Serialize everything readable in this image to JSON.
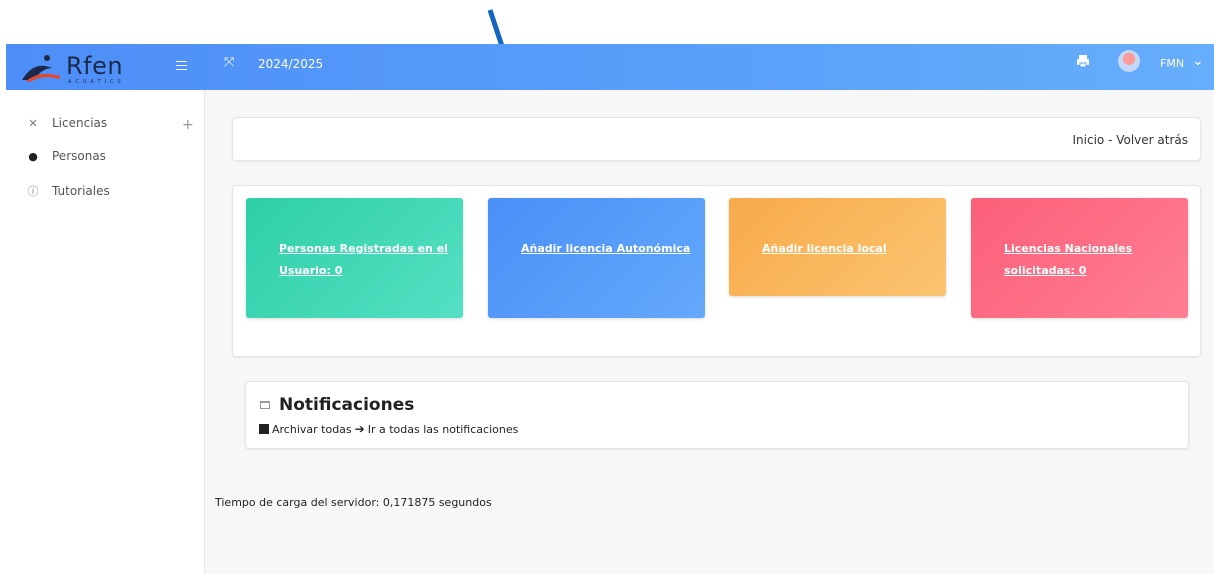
{
  "header": {
    "logo_text": "Rfen",
    "logo_sub": "ACUATICS",
    "season": "2024/2025",
    "user": "FMN",
    "colors": {
      "bar": "#5aa0fa",
      "logo": "#1b2a4a"
    }
  },
  "sidebar": {
    "items": [
      {
        "label": "Licencias",
        "icon": "tools-icon"
      },
      {
        "label": "Personas",
        "icon": "person-icon"
      },
      {
        "label": "Tutoriales",
        "icon": "info-icon"
      }
    ]
  },
  "breadcrumb": {
    "text": "Inicio - Volver atrás"
  },
  "tiles": [
    {
      "label": "Personas Registradas en el Usuario: 0",
      "color": "#2fcfa8"
    },
    {
      "label": "Añadir licencia Autonómica",
      "color": "#4a8ff7"
    },
    {
      "label": "Añadir licencia local",
      "color": "#f8aa4a"
    },
    {
      "label": "Licencias Nacionales solicitadas: 0",
      "color": "#fb5f79"
    }
  ],
  "notifications": {
    "title": "Notificaciones",
    "archive_label": "Archivar todas",
    "all_label": "Ir a todas las notificaciones"
  },
  "footer": {
    "load_time": "Tiempo de carga del servidor: 0,171875 segundos"
  },
  "annotation": {
    "arrow_color": "#1565c0"
  }
}
